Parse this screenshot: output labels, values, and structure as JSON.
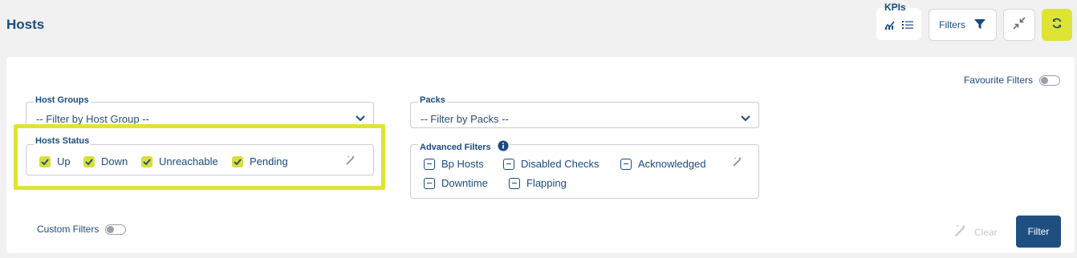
{
  "header": {
    "title": "Hosts",
    "kpis_label": "KPIs",
    "filters_label": "Filters"
  },
  "favourite": {
    "label": "Favourite Filters",
    "enabled": false
  },
  "host_groups": {
    "label": "Host Groups",
    "value": "-- Filter by Host Group --"
  },
  "packs": {
    "label": "Packs",
    "value": "-- Filter by Packs --"
  },
  "hosts_status": {
    "label": "Hosts Status",
    "options": [
      {
        "label": "Up",
        "checked": true
      },
      {
        "label": "Down",
        "checked": true
      },
      {
        "label": "Unreachable",
        "checked": true
      },
      {
        "label": "Pending",
        "checked": true
      }
    ]
  },
  "advanced_filters": {
    "label": "Advanced Filters",
    "options": [
      {
        "label": "Bp Hosts"
      },
      {
        "label": "Disabled Checks"
      },
      {
        "label": "Acknowledged"
      },
      {
        "label": "Downtime"
      },
      {
        "label": "Flapping"
      }
    ]
  },
  "custom_filters": {
    "label": "Custom Filters",
    "enabled": false
  },
  "actions": {
    "clear_label": "Clear",
    "filter_label": "Filter"
  },
  "colors": {
    "accent": "#dfe434",
    "primary": "#1f4f80"
  }
}
